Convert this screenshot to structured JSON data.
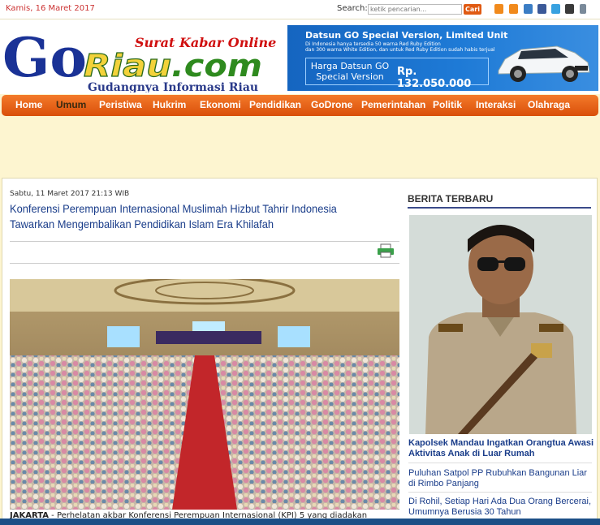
{
  "topbar": {
    "date": "Kamis, 16 Maret 2017",
    "search_label": "Search:",
    "search_placeholder": "ketik pencarian...",
    "search_button": "Cari"
  },
  "logo": {
    "tagline_top": "Surat Kabar Online",
    "name_go": "Go",
    "name_riau": "Riau",
    "name_com": ".com",
    "tagline_bottom": "Gudangnya Informasi Riau"
  },
  "ad": {
    "title": "Datsun GO Special Version, Limited Unit",
    "sub1": "Di Indonesia hanya tersedia 50 warna Red Ruby Edition",
    "sub2": "dan 300 warna White Edition, dan untuk Red Ruby Edition sudah habis terjual",
    "harga_line1": "Harga Datsun GO",
    "harga_line2": "Special Version",
    "price": "Rp. 132.050.000"
  },
  "nav": {
    "items": [
      "Home",
      "Umum",
      "Peristiwa",
      "Hukrim",
      "Ekonomi",
      "Pendidikan",
      "GoDrone",
      "Pemerintahan",
      "Politik",
      "Interaksi",
      "Olahraga"
    ]
  },
  "article": {
    "date": "Sabtu, 11 Maret 2017 21:13 WIB",
    "title": "Konferensi Perempuan Internasional Muslimah Hizbut Tahrir Indonesia Tawarkan Mengembalikan Pendidikan Islam Era Khilafah",
    "lead_city": "JAKARTA",
    "lead_text": " - Perhelatan akbar Konferensi Perempuan Internasional (KPI) 5 yang diadakan"
  },
  "sidebar": {
    "title": "BERITA TERBARU",
    "featured_title": "Kapolsek Mandau Ingatkan Orangtua Awasi Aktivitas Anak di Luar Rumah",
    "items": [
      "Puluhan Satpol PP Rubuhkan Bangunan Liar di Rimbo Panjang",
      "Di Rohil, Setiap Hari Ada Dua Orang Bercerai, Umumnya Berusia 30 Tahun"
    ]
  },
  "colors": {
    "nav_orange": "#e8621a",
    "link_blue": "#1a3d8a",
    "page_bg": "#fdf5d0"
  }
}
